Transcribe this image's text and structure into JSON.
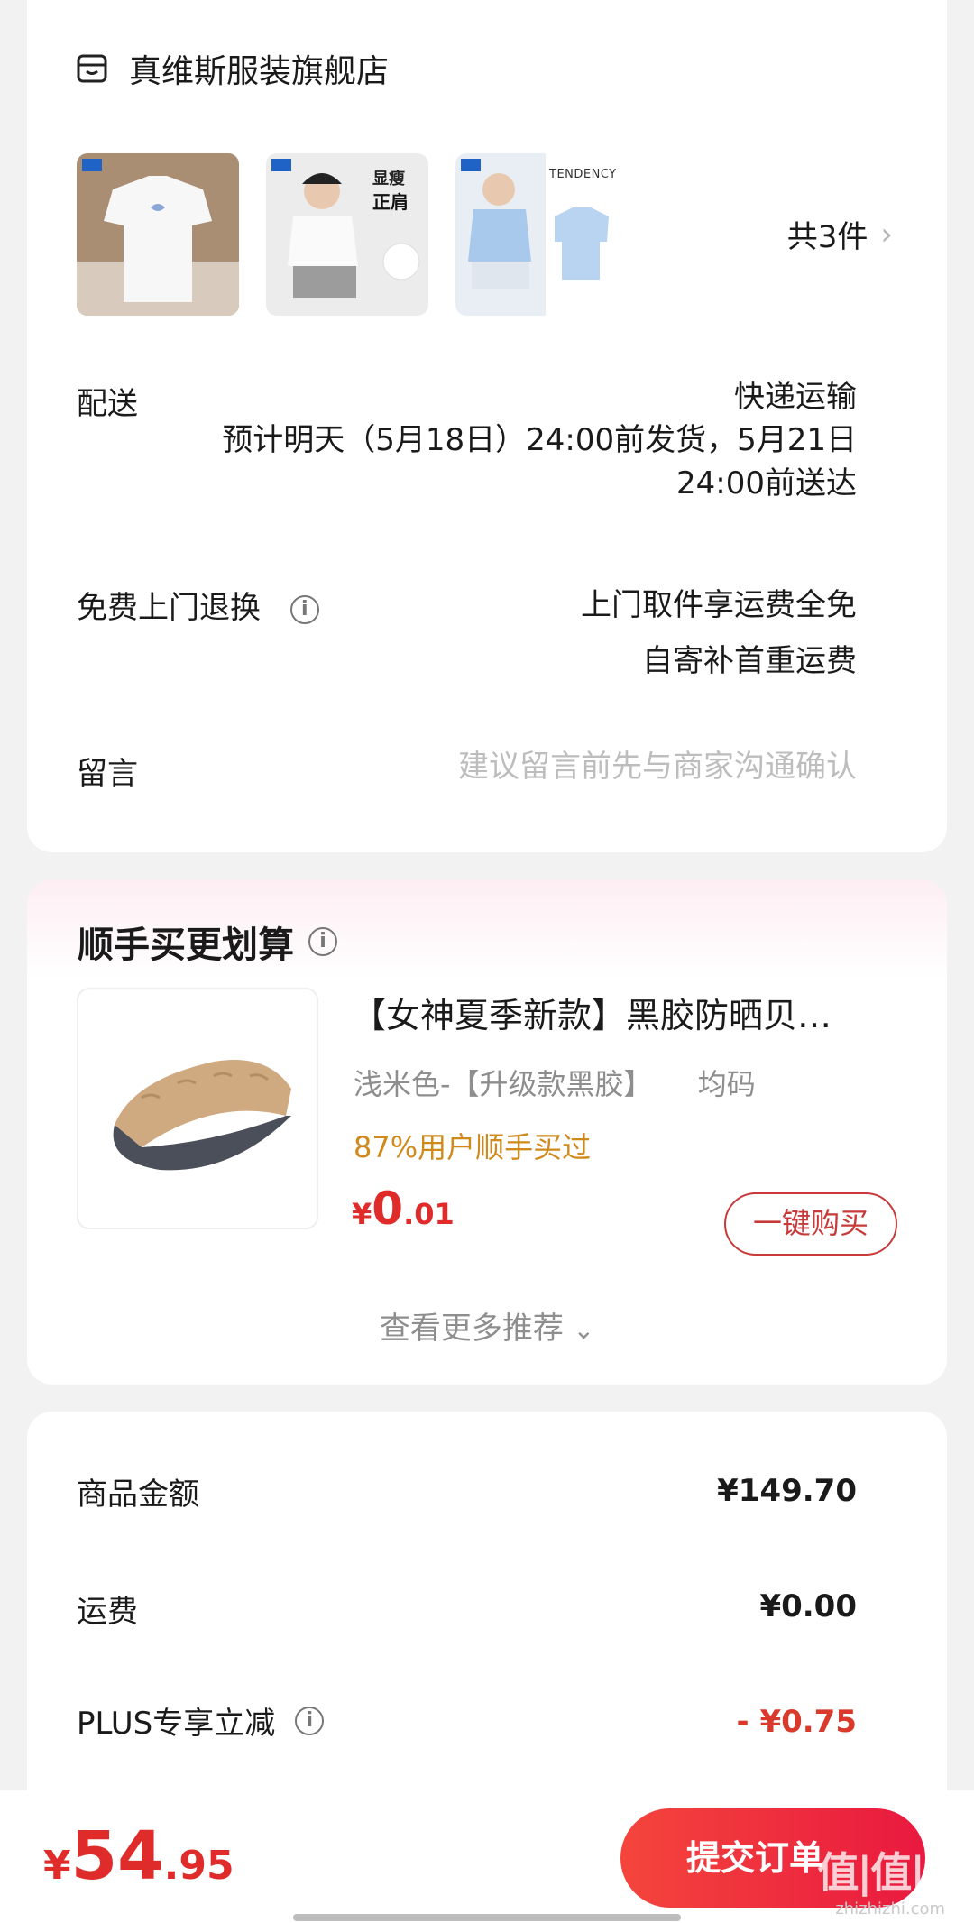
{
  "store": {
    "name": "真维斯服装旗舰店",
    "icon": "store-icon"
  },
  "items": {
    "count_label": "共3件",
    "thumb3_caption": "TENDENCY",
    "thumb2_badge1": "显瘦",
    "thumb2_badge2": "正肩"
  },
  "delivery": {
    "label": "配送",
    "method": "快递运输",
    "estimate_line1": "预计明天（5月18日）24:00前发货，5月21日",
    "estimate_line2": "24:00前送达"
  },
  "returns": {
    "label": "免费上门退换",
    "value_line1": "上门取件享运费全免",
    "value_line2": "自寄补首重运费"
  },
  "message": {
    "label": "留言",
    "placeholder": "建议留言前先与商家沟通确认"
  },
  "addon": {
    "title": "顺手买更划算",
    "product": {
      "title": "【女神夏季新款】黑胶防晒贝…",
      "spec_color": "浅米色-【升级款黑胶】",
      "spec_size": "均码",
      "social": "87%用户顺手买过",
      "price_currency": "¥",
      "price_int": "0",
      "price_dec": ".01",
      "buy_label": "一键购买"
    },
    "more_label": "查看更多推荐"
  },
  "summary": {
    "goods_label": "商品金额",
    "goods_value": "¥149.70",
    "shipping_label": "运费",
    "shipping_value": "¥0.00",
    "plus_label": "PLUS专享立减",
    "plus_value": "- ¥0.75"
  },
  "footer": {
    "total_currency": "¥",
    "total_int": "54",
    "total_dec": ".95",
    "submit_label": "提交订单",
    "watermark_logo": "值|值|值",
    "watermark_url": "zhizhizhi.com"
  },
  "colors": {
    "accent_red": "#e02b2b",
    "social_orange": "#d08a1c",
    "placeholder_gray": "#bdbdbd"
  }
}
